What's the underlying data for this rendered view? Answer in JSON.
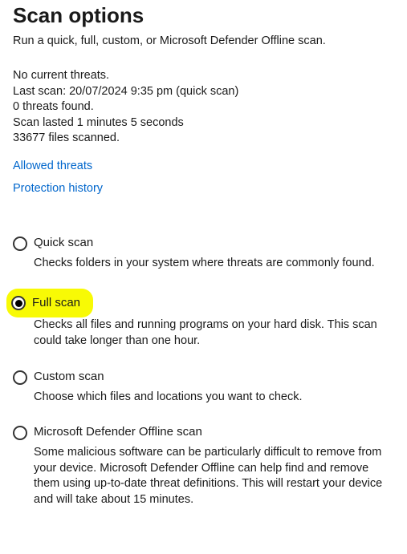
{
  "title": "Scan options",
  "subtitle": "Run a quick, full, custom, or Microsoft Defender Offline scan.",
  "status": {
    "no_threats": "No current threats.",
    "last_scan": "Last scan: 20/07/2024 9:35 pm (quick scan)",
    "threats_found": "0 threats found.",
    "duration": "Scan lasted 1 minutes 5 seconds",
    "files_scanned": "33677 files scanned."
  },
  "links": {
    "allowed_threats": "Allowed threats",
    "protection_history": "Protection history"
  },
  "options": {
    "quick": {
      "label": "Quick scan",
      "desc": "Checks folders in your system where threats are commonly found.",
      "selected": false
    },
    "full": {
      "label": "Full scan",
      "desc": "Checks all files and running programs on your hard disk. This scan could take longer than one hour.",
      "selected": true
    },
    "custom": {
      "label": "Custom scan",
      "desc": "Choose which files and locations you want to check.",
      "selected": false
    },
    "offline": {
      "label": "Microsoft Defender Offline scan",
      "desc": "Some malicious software can be particularly difficult to remove from your device. Microsoft Defender Offline can help find and remove them using up-to-date threat definitions. This will restart your device and will take about 15 minutes.",
      "selected": false
    }
  }
}
